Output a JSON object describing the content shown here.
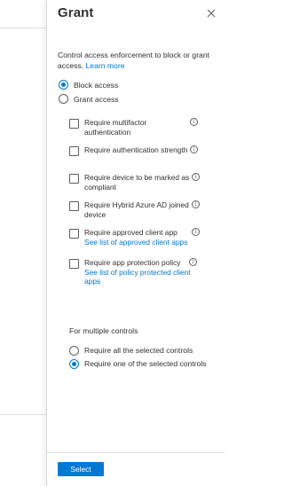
{
  "blade": {
    "title": "Grant",
    "close_icon": "close-icon",
    "description": "Control access enforcement to block or grant access.",
    "learn_more": "Learn more"
  },
  "access": {
    "options": [
      {
        "label": "Block access",
        "selected": true
      },
      {
        "label": "Grant access",
        "selected": false
      }
    ]
  },
  "controls": [
    {
      "label": "Require multifactor authentication",
      "checked": false,
      "link": ""
    },
    {
      "label": "Require authentication strength",
      "checked": false,
      "link": ""
    },
    {
      "label": "Require device to be marked as compliant",
      "checked": false,
      "link": ""
    },
    {
      "label": "Require Hybrid Azure AD joined device",
      "checked": false,
      "link": ""
    },
    {
      "label": "Require approved client app",
      "checked": false,
      "link": "See list of approved client apps"
    },
    {
      "label": "Require app protection policy",
      "checked": false,
      "link": "See list of policy protected client apps"
    }
  ],
  "multiple": {
    "label": "For multiple controls",
    "options": [
      {
        "label": "Require all the selected controls",
        "selected": false
      },
      {
        "label": "Require one of the selected controls",
        "selected": true
      }
    ]
  },
  "footer": {
    "select_label": "Select"
  },
  "colors": {
    "accent": "#0078d4",
    "text": "#323130",
    "border": "#605e5c"
  }
}
